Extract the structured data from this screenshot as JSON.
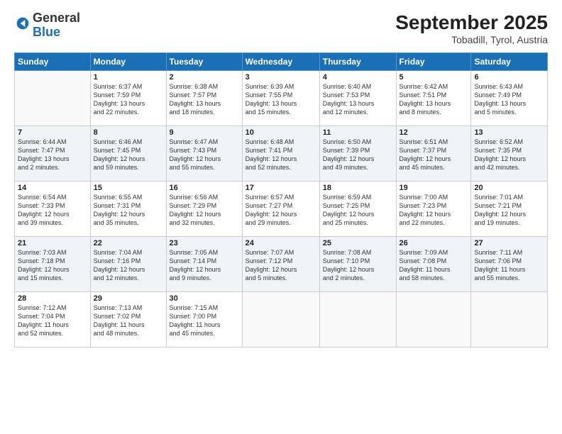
{
  "header": {
    "logo_general": "General",
    "logo_blue": "Blue",
    "month": "September 2025",
    "location": "Tobadill, Tyrol, Austria"
  },
  "columns": [
    "Sunday",
    "Monday",
    "Tuesday",
    "Wednesday",
    "Thursday",
    "Friday",
    "Saturday"
  ],
  "weeks": [
    [
      {
        "day": "",
        "info": ""
      },
      {
        "day": "1",
        "info": "Sunrise: 6:37 AM\nSunset: 7:59 PM\nDaylight: 13 hours\nand 22 minutes."
      },
      {
        "day": "2",
        "info": "Sunrise: 6:38 AM\nSunset: 7:57 PM\nDaylight: 13 hours\nand 18 minutes."
      },
      {
        "day": "3",
        "info": "Sunrise: 6:39 AM\nSunset: 7:55 PM\nDaylight: 13 hours\nand 15 minutes."
      },
      {
        "day": "4",
        "info": "Sunrise: 6:40 AM\nSunset: 7:53 PM\nDaylight: 13 hours\nand 12 minutes."
      },
      {
        "day": "5",
        "info": "Sunrise: 6:42 AM\nSunset: 7:51 PM\nDaylight: 13 hours\nand 8 minutes."
      },
      {
        "day": "6",
        "info": "Sunrise: 6:43 AM\nSunset: 7:49 PM\nDaylight: 13 hours\nand 5 minutes."
      }
    ],
    [
      {
        "day": "7",
        "info": "Sunrise: 6:44 AM\nSunset: 7:47 PM\nDaylight: 13 hours\nand 2 minutes."
      },
      {
        "day": "8",
        "info": "Sunrise: 6:46 AM\nSunset: 7:45 PM\nDaylight: 12 hours\nand 59 minutes."
      },
      {
        "day": "9",
        "info": "Sunrise: 6:47 AM\nSunset: 7:43 PM\nDaylight: 12 hours\nand 55 minutes."
      },
      {
        "day": "10",
        "info": "Sunrise: 6:48 AM\nSunset: 7:41 PM\nDaylight: 12 hours\nand 52 minutes."
      },
      {
        "day": "11",
        "info": "Sunrise: 6:50 AM\nSunset: 7:39 PM\nDaylight: 12 hours\nand 49 minutes."
      },
      {
        "day": "12",
        "info": "Sunrise: 6:51 AM\nSunset: 7:37 PM\nDaylight: 12 hours\nand 45 minutes."
      },
      {
        "day": "13",
        "info": "Sunrise: 6:52 AM\nSunset: 7:35 PM\nDaylight: 12 hours\nand 42 minutes."
      }
    ],
    [
      {
        "day": "14",
        "info": "Sunrise: 6:54 AM\nSunset: 7:33 PM\nDaylight: 12 hours\nand 39 minutes."
      },
      {
        "day": "15",
        "info": "Sunrise: 6:55 AM\nSunset: 7:31 PM\nDaylight: 12 hours\nand 35 minutes."
      },
      {
        "day": "16",
        "info": "Sunrise: 6:56 AM\nSunset: 7:29 PM\nDaylight: 12 hours\nand 32 minutes."
      },
      {
        "day": "17",
        "info": "Sunrise: 6:57 AM\nSunset: 7:27 PM\nDaylight: 12 hours\nand 29 minutes."
      },
      {
        "day": "18",
        "info": "Sunrise: 6:59 AM\nSunset: 7:25 PM\nDaylight: 12 hours\nand 25 minutes."
      },
      {
        "day": "19",
        "info": "Sunrise: 7:00 AM\nSunset: 7:23 PM\nDaylight: 12 hours\nand 22 minutes."
      },
      {
        "day": "20",
        "info": "Sunrise: 7:01 AM\nSunset: 7:21 PM\nDaylight: 12 hours\nand 19 minutes."
      }
    ],
    [
      {
        "day": "21",
        "info": "Sunrise: 7:03 AM\nSunset: 7:18 PM\nDaylight: 12 hours\nand 15 minutes."
      },
      {
        "day": "22",
        "info": "Sunrise: 7:04 AM\nSunset: 7:16 PM\nDaylight: 12 hours\nand 12 minutes."
      },
      {
        "day": "23",
        "info": "Sunrise: 7:05 AM\nSunset: 7:14 PM\nDaylight: 12 hours\nand 9 minutes."
      },
      {
        "day": "24",
        "info": "Sunrise: 7:07 AM\nSunset: 7:12 PM\nDaylight: 12 hours\nand 5 minutes."
      },
      {
        "day": "25",
        "info": "Sunrise: 7:08 AM\nSunset: 7:10 PM\nDaylight: 12 hours\nand 2 minutes."
      },
      {
        "day": "26",
        "info": "Sunrise: 7:09 AM\nSunset: 7:08 PM\nDaylight: 11 hours\nand 58 minutes."
      },
      {
        "day": "27",
        "info": "Sunrise: 7:11 AM\nSunset: 7:06 PM\nDaylight: 11 hours\nand 55 minutes."
      }
    ],
    [
      {
        "day": "28",
        "info": "Sunrise: 7:12 AM\nSunset: 7:04 PM\nDaylight: 11 hours\nand 52 minutes."
      },
      {
        "day": "29",
        "info": "Sunrise: 7:13 AM\nSunset: 7:02 PM\nDaylight: 11 hours\nand 48 minutes."
      },
      {
        "day": "30",
        "info": "Sunrise: 7:15 AM\nSunset: 7:00 PM\nDaylight: 11 hours\nand 45 minutes."
      },
      {
        "day": "",
        "info": ""
      },
      {
        "day": "",
        "info": ""
      },
      {
        "day": "",
        "info": ""
      },
      {
        "day": "",
        "info": ""
      }
    ]
  ]
}
